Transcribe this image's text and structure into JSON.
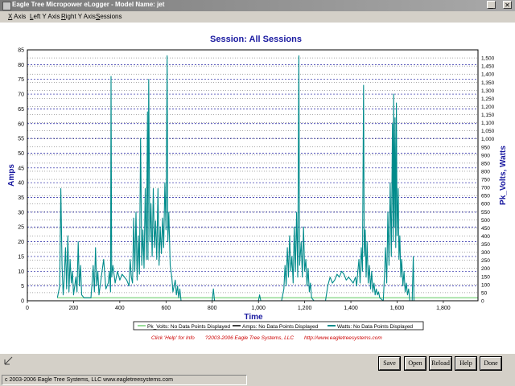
{
  "window": {
    "title": "Eagle Tree Micropower eLogger - Model Name: jet"
  },
  "menu": [
    "X Axis",
    "Left Y Axis",
    "Right Y Axis",
    "Sessions"
  ],
  "chart_data": {
    "type": "line",
    "title": "Session: All Sessions",
    "xlabel": "Time",
    "ylabel_left": "Amps",
    "ylabel_right": "Pk_Volts, Watts",
    "xlim": [
      0,
      1950
    ],
    "ylim_left": [
      0,
      85
    ],
    "ylim_right": [
      0,
      1550
    ],
    "x_ticks": [
      "0",
      "200",
      "400",
      "600",
      "800",
      "1,000",
      "1,200",
      "1,400",
      "1,600",
      "1,800"
    ],
    "x_tick_values": [
      0,
      200,
      400,
      600,
      800,
      1000,
      1200,
      1400,
      1600,
      1800
    ],
    "y_left_ticks": [
      0,
      5,
      10,
      15,
      20,
      25,
      30,
      35,
      40,
      45,
      50,
      55,
      60,
      65,
      70,
      75,
      80,
      85
    ],
    "y_right_ticks": [
      "0",
      "50",
      "100",
      "150",
      "200",
      "250",
      "300",
      "350",
      "400",
      "450",
      "500",
      "550",
      "600",
      "650",
      "700",
      "750",
      "800",
      "850",
      "900",
      "950",
      "1,000",
      "1,050",
      "1,100",
      "1,150",
      "1,200",
      "1,250",
      "1,300",
      "1,350",
      "1,400",
      "1,450",
      "1,500"
    ],
    "y_right_tick_values": [
      0,
      50,
      100,
      150,
      200,
      250,
      300,
      350,
      400,
      450,
      500,
      550,
      600,
      650,
      700,
      750,
      800,
      850,
      900,
      950,
      1000,
      1050,
      1100,
      1150,
      1200,
      1250,
      1300,
      1350,
      1400,
      1450,
      1500
    ],
    "grid": true,
    "legend_position": "bottom",
    "series": [
      {
        "name": "Pk_Volts: No Data Points Displayed",
        "color": "#99dd99",
        "points": [
          [
            130,
            1
          ],
          [
            1950,
            1
          ]
        ]
      },
      {
        "name": "Amps: No Data Points Displayed",
        "color": "#000000",
        "points": []
      },
      {
        "name": "Watts: No Data Points Displayed",
        "color": "#008b8b",
        "points": [
          [
            130,
            1
          ],
          [
            140,
            5
          ],
          [
            145,
            38
          ],
          [
            150,
            12
          ],
          [
            155,
            2
          ],
          [
            160,
            8
          ],
          [
            165,
            18
          ],
          [
            170,
            4
          ],
          [
            175,
            22
          ],
          [
            180,
            3
          ],
          [
            185,
            14
          ],
          [
            190,
            6
          ],
          [
            195,
            10
          ],
          [
            200,
            2
          ],
          [
            210,
            8
          ],
          [
            215,
            3
          ],
          [
            220,
            20
          ],
          [
            225,
            5
          ],
          [
            230,
            12
          ],
          [
            235,
            2
          ],
          [
            245,
            1
          ],
          [
            255,
            1
          ],
          [
            275,
            1
          ],
          [
            280,
            6
          ],
          [
            285,
            12
          ],
          [
            290,
            3
          ],
          [
            295,
            18
          ],
          [
            300,
            5
          ],
          [
            305,
            10
          ],
          [
            310,
            2
          ],
          [
            320,
            8
          ],
          [
            330,
            14
          ],
          [
            340,
            4
          ],
          [
            350,
            6
          ],
          [
            355,
            10
          ],
          [
            360,
            3
          ],
          [
            362,
            76
          ],
          [
            365,
            8
          ],
          [
            370,
            12
          ],
          [
            380,
            6
          ],
          [
            390,
            10
          ],
          [
            400,
            7
          ],
          [
            410,
            9
          ],
          [
            420,
            8
          ],
          [
            430,
            7
          ],
          [
            440,
            5
          ],
          [
            445,
            14
          ],
          [
            450,
            8
          ],
          [
            455,
            6
          ],
          [
            460,
            28
          ],
          [
            465,
            10
          ],
          [
            470,
            30
          ],
          [
            475,
            7
          ],
          [
            480,
            22
          ],
          [
            485,
            9
          ],
          [
            490,
            55
          ],
          [
            495,
            12
          ],
          [
            500,
            24
          ],
          [
            505,
            11
          ],
          [
            510,
            38
          ],
          [
            515,
            14
          ],
          [
            520,
            64
          ],
          [
            522,
            14
          ],
          [
            525,
            75
          ],
          [
            530,
            20
          ],
          [
            535,
            33
          ],
          [
            540,
            15
          ],
          [
            545,
            38
          ],
          [
            550,
            18
          ],
          [
            555,
            27
          ],
          [
            560,
            14
          ],
          [
            565,
            38
          ],
          [
            570,
            12
          ],
          [
            575,
            25
          ],
          [
            580,
            16
          ],
          [
            585,
            28
          ],
          [
            590,
            18
          ],
          [
            595,
            40
          ],
          [
            600,
            24
          ],
          [
            605,
            83
          ],
          [
            608,
            20
          ],
          [
            612,
            30
          ],
          [
            618,
            12
          ],
          [
            625,
            8
          ],
          [
            630,
            3
          ],
          [
            640,
            7
          ],
          [
            645,
            2
          ],
          [
            650,
            5
          ],
          [
            655,
            1
          ],
          [
            660,
            4
          ],
          [
            665,
            0
          ],
          [
            800,
            0
          ],
          [
            805,
            4
          ],
          [
            810,
            0
          ],
          [
            1000,
            0
          ],
          [
            1005,
            2
          ],
          [
            1010,
            0
          ],
          [
            1100,
            0
          ],
          [
            1110,
            4
          ],
          [
            1115,
            12
          ],
          [
            1120,
            5
          ],
          [
            1125,
            18
          ],
          [
            1130,
            8
          ],
          [
            1135,
            22
          ],
          [
            1140,
            10
          ],
          [
            1145,
            15
          ],
          [
            1150,
            6
          ],
          [
            1155,
            25
          ],
          [
            1160,
            10
          ],
          [
            1165,
            30
          ],
          [
            1170,
            8
          ],
          [
            1175,
            83
          ],
          [
            1178,
            12
          ],
          [
            1185,
            20
          ],
          [
            1190,
            8
          ],
          [
            1195,
            25
          ],
          [
            1200,
            10
          ],
          [
            1205,
            14
          ],
          [
            1210,
            5
          ],
          [
            1215,
            11
          ],
          [
            1220,
            3
          ],
          [
            1225,
            6
          ],
          [
            1230,
            1
          ],
          [
            1240,
            0
          ],
          [
            1290,
            0
          ],
          [
            1300,
            5
          ],
          [
            1310,
            8
          ],
          [
            1320,
            6
          ],
          [
            1330,
            7
          ],
          [
            1340,
            9
          ],
          [
            1350,
            8
          ],
          [
            1360,
            10
          ],
          [
            1370,
            9
          ],
          [
            1380,
            7
          ],
          [
            1390,
            8
          ],
          [
            1400,
            7
          ],
          [
            1410,
            6
          ],
          [
            1420,
            8
          ],
          [
            1425,
            5
          ],
          [
            1430,
            10
          ],
          [
            1435,
            14
          ],
          [
            1440,
            6
          ],
          [
            1445,
            18
          ],
          [
            1450,
            10
          ],
          [
            1455,
            73
          ],
          [
            1458,
            15
          ],
          [
            1462,
            24
          ],
          [
            1466,
            8
          ],
          [
            1470,
            20
          ],
          [
            1475,
            6
          ],
          [
            1480,
            12
          ],
          [
            1485,
            4
          ],
          [
            1490,
            10
          ],
          [
            1495,
            3
          ],
          [
            1500,
            6
          ],
          [
            1505,
            2
          ],
          [
            1510,
            4
          ],
          [
            1515,
            2
          ],
          [
            1520,
            3
          ],
          [
            1525,
            1
          ],
          [
            1540,
            0
          ],
          [
            1545,
            8
          ],
          [
            1550,
            18
          ],
          [
            1555,
            6
          ],
          [
            1560,
            30
          ],
          [
            1565,
            12
          ],
          [
            1570,
            40
          ],
          [
            1575,
            15
          ],
          [
            1580,
            60
          ],
          [
            1583,
            20
          ],
          [
            1585,
            70
          ],
          [
            1588,
            25
          ],
          [
            1591,
            62
          ],
          [
            1594,
            18
          ],
          [
            1597,
            67
          ],
          [
            1600,
            22
          ],
          [
            1605,
            38
          ],
          [
            1608,
            14
          ],
          [
            1612,
            22
          ],
          [
            1616,
            8
          ],
          [
            1620,
            14
          ],
          [
            1625,
            5
          ],
          [
            1630,
            10
          ],
          [
            1635,
            3
          ],
          [
            1640,
            6
          ],
          [
            1645,
            2
          ],
          [
            1650,
            4
          ],
          [
            1655,
            0
          ],
          [
            1665,
            0
          ],
          [
            1670,
            15
          ],
          [
            1673,
            0
          ],
          [
            1950,
            0
          ]
        ]
      }
    ]
  },
  "footer": {
    "info": "Click 'Help' for Info",
    "copyright": "?2003-2006 Eagle Tree Systems, LLC",
    "url": "http://www.eagletreesystems.com"
  },
  "buttons": {
    "save": "Save",
    "open": "Open",
    "reload": "Reload",
    "help": "Help",
    "done": "Done"
  },
  "status": {
    "text": "c 2003-2006 Eagle Tree Systems, LLC     www.eagletreesystems.com"
  }
}
